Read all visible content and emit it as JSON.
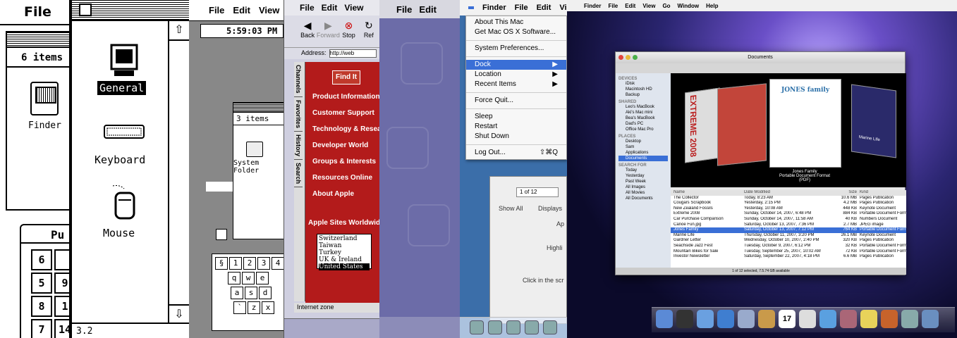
{
  "p1": {
    "menu": [
      "File"
    ],
    "items_count": "6 items",
    "finder_label": "Finder",
    "puzzle_title": "Pu",
    "tiles": [
      "6",
      "",
      "5",
      "9",
      "8",
      "1",
      "7",
      "14"
    ]
  },
  "p2": {
    "general": "General",
    "keyboard": "Keyboard",
    "mouse": "Mouse",
    "status": "3.2"
  },
  "p3": {
    "menu": [
      "File",
      "Edit",
      "View"
    ],
    "clock": "5:59:03 PM",
    "items": "3 items",
    "system_folder": "System Folder",
    "keys_row1": [
      "§",
      "1",
      "2",
      "3",
      "4"
    ],
    "keys_row2": [
      "q",
      "w",
      "e"
    ],
    "keys_row3": [
      "a",
      "s",
      "d"
    ],
    "keys_row4": [
      "`",
      "z",
      "x"
    ]
  },
  "p4": {
    "menu": [
      "File",
      "Edit",
      "View"
    ],
    "toolbar": [
      "Back",
      "Forward",
      "Stop",
      "Ref"
    ],
    "address_label": "Address:",
    "address_value": "http://web",
    "tabs": [
      "Channels",
      "Favorites",
      "History",
      "Search"
    ],
    "find_it": "Find It",
    "links": [
      "Product Information",
      "Customer Support",
      "Technology & Research",
      "Developer World",
      "Groups & Interests",
      "Resources Online",
      "About Apple"
    ],
    "sites_heading": "Apple Sites Worldwide",
    "countries": [
      "Switzerland",
      "Taiwan",
      "Turkey",
      "UK & Ireland",
      "United States"
    ],
    "status": "Internet zone"
  },
  "p5": {
    "menu": [
      "File",
      "Edit"
    ]
  },
  "p6": {
    "menu": [
      "Finder",
      "File",
      "Edit",
      "Vie"
    ],
    "apple_menu": [
      {
        "label": "About This Mac",
        "shortcut": ""
      },
      {
        "label": "Get Mac OS X Software...",
        "shortcut": ""
      },
      {
        "label": "System Preferences...",
        "shortcut": ""
      },
      {
        "label": "Dock",
        "shortcut": "▶"
      },
      {
        "label": "Location",
        "shortcut": "▶"
      },
      {
        "label": "Recent Items",
        "shortcut": "▶"
      },
      {
        "label": "Force Quit...",
        "shortcut": ""
      },
      {
        "label": "Sleep",
        "shortcut": ""
      },
      {
        "label": "Restart",
        "shortcut": ""
      },
      {
        "label": "Shut Down",
        "shortcut": ""
      },
      {
        "label": "Log Out...",
        "shortcut": "⇧⌘Q"
      }
    ],
    "show_all": "Show All",
    "displays": "Displays",
    "stepper": "1 of 12",
    "pref_text1": "Ap",
    "pref_text2": "Highli",
    "pref_text3": "Click in the scr"
  },
  "p7": {
    "menu": [
      "Finder",
      "File",
      "Edit",
      "View",
      "Go",
      "Window",
      "Help"
    ],
    "window_title": "Documents",
    "sidebar": [
      {
        "type": "h",
        "label": "DEVICES"
      },
      {
        "type": "i",
        "label": "iDisk"
      },
      {
        "type": "i",
        "label": "Macintosh HD"
      },
      {
        "type": "i",
        "label": "Backup"
      },
      {
        "type": "h",
        "label": "SHARED"
      },
      {
        "type": "i",
        "label": "Leo's MacBook"
      },
      {
        "type": "i",
        "label": "Aki's Mac mini"
      },
      {
        "type": "i",
        "label": "Bea's MacBook"
      },
      {
        "type": "i",
        "label": "Dad's PC"
      },
      {
        "type": "i",
        "label": "Office Mac Pro"
      },
      {
        "type": "h",
        "label": "PLACES"
      },
      {
        "type": "i",
        "label": "Desktop"
      },
      {
        "type": "i",
        "label": "Sam"
      },
      {
        "type": "i",
        "label": "Applications"
      },
      {
        "type": "i",
        "label": "Documents",
        "sel": true
      },
      {
        "type": "h",
        "label": "SEARCH FOR"
      },
      {
        "type": "i",
        "label": "Today"
      },
      {
        "type": "i",
        "label": "Yesterday"
      },
      {
        "type": "i",
        "label": "Past Week"
      },
      {
        "type": "i",
        "label": "All Images"
      },
      {
        "type": "i",
        "label": "All Movies"
      },
      {
        "type": "i",
        "label": "All Documents"
      }
    ],
    "cover_title": "Jones Family",
    "cover_sub": "Portable Document Format (PDF)",
    "cover_brand": "JONES family",
    "cover_left": "EXTREME 2008",
    "cover_right": "Marine Life",
    "columns": [
      "Name",
      "Date Modified",
      "Size",
      "Kind"
    ],
    "files": [
      [
        "The Collector",
        "Today, 8:23 AM",
        "10.6 MB",
        "Pages Publication"
      ],
      [
        "Cougars Scrapbook",
        "Yesterday, 2:15 PM",
        "4.2 MB",
        "Pages Publication"
      ],
      [
        "New Zealand Fossils",
        "Yesterday, 10:08 AM",
        "448 KB",
        "Keynote Document"
      ],
      [
        "Extreme 2008",
        "Sunday, October 14, 2007, 6:48 PM",
        "884 KB",
        "Portable Document Format (PDF)"
      ],
      [
        "Car Purchase Comparison",
        "Sunday, October 14, 2007, 11:58 AM",
        "40 KB",
        "Numbers Document"
      ],
      [
        "Canoe Fun.jpg",
        "Saturday, October 13, 2007, 7:36 PM",
        "2.7 MB",
        "JPEG image"
      ],
      [
        "Jones Family",
        "Saturday, October 13, 2007, 7:12 PM",
        "764 KB",
        "Portable Document Format (PDF)"
      ],
      [
        "Marine Life",
        "Thursday, October 11, 2007, 3:20 PM",
        "26.1 MB",
        "Keynote Document"
      ],
      [
        "Gardner Letter",
        "Wednesday, October 10, 2007, 2:40 PM",
        "320 KB",
        "Pages Publication"
      ],
      [
        "Seachside Jazz Fest",
        "Tuesday, October 9, 2007, 6:12 PM",
        "32 KB",
        "Portable Document Format (PDF)"
      ],
      [
        "Mountain Bikes for Sale",
        "Tuesday, September 25, 2007, 10:02 AM",
        "72 KB",
        "Portable Document Format (PDF)"
      ],
      [
        "Investor Newsletter",
        "Saturday, September 22, 2007, 4:18 PM",
        "6.6 MB",
        "Pages Publication"
      ]
    ],
    "selected_index": 6,
    "footer": "1 of 12 selected, 7.5.74 GB available",
    "dock_day": "17"
  }
}
